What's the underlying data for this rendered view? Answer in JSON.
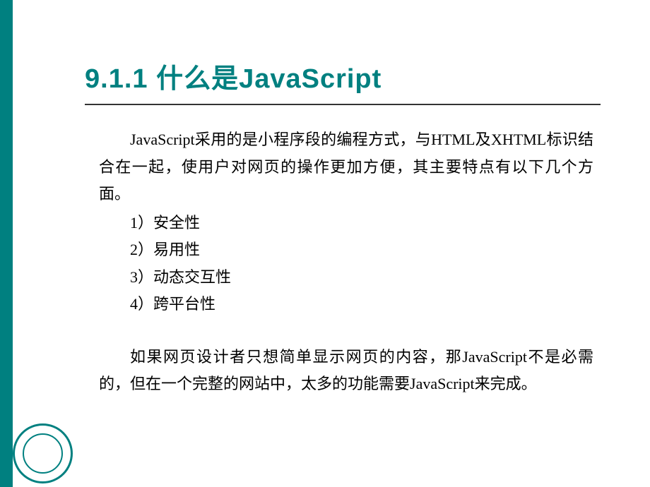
{
  "title": "9.1.1 什么是JavaScript",
  "intro_paragraph": "JavaScript采用的是小程序段的编程方式，与HTML及XHTML标识结合在一起，使用户对网页的操作更加方便，其主要特点有以下几个方面。",
  "list": {
    "item1": "1）安全性",
    "item2": "2）易用性",
    "item3": "3）动态交互性",
    "item4": "4）跨平台性"
  },
  "conclusion_paragraph": "如果网页设计者只想简单显示网页的内容，那JavaScript不是必需的，但在一个完整的网站中，太多的功能需要JavaScript来完成。"
}
